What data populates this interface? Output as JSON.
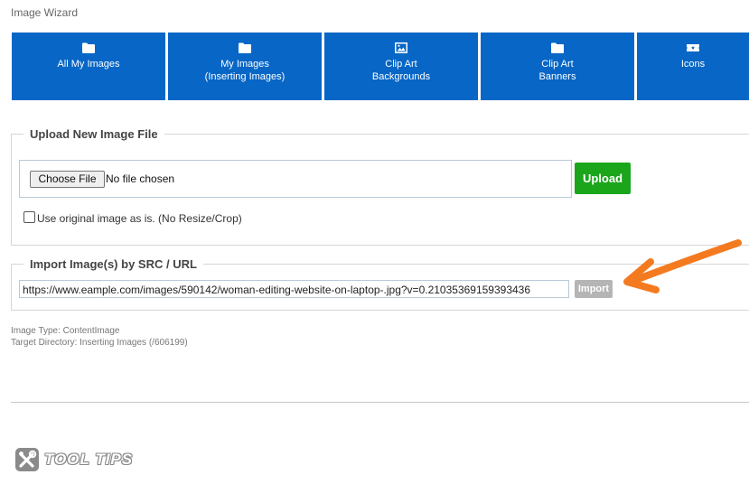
{
  "header": {
    "title": "Image Wizard"
  },
  "tabs": [
    {
      "line1": "All My Images",
      "line2": "",
      "icon": "folder-icon"
    },
    {
      "line1": "My Images",
      "line2": "(Inserting Images)",
      "icon": "folder-icon"
    },
    {
      "line1": "Clip Art",
      "line2": "Backgrounds",
      "icon": "image-frame-icon"
    },
    {
      "line1": "Clip Art",
      "line2": "Banners",
      "icon": "folder-icon"
    },
    {
      "line1": "Icons",
      "line2": "",
      "icon": "ticket-icon"
    }
  ],
  "upload": {
    "legend": "Upload New Image File",
    "choose_label": "Choose File",
    "no_file_text": "No file chosen",
    "upload_label": "Upload",
    "checkbox_label": "Use original image as is. (No Resize/Crop)",
    "checkbox_checked": false
  },
  "import": {
    "legend": "Import Image(s) by SRC / URL",
    "url_value": "https://www.eample.com/images/590142/woman-editing-website-on-laptop-.jpg?v=0.21035369159393436",
    "button_label": "Import"
  },
  "meta": {
    "image_type": "Image Type: ContentImage",
    "target_directory": "Target Directory: Inserting Images (/606199)"
  },
  "watermark": {
    "text": "TOOL TIPS"
  },
  "colors": {
    "tab_blue": "#0766c6",
    "upload_green": "#1aa51a",
    "import_gray": "#b5b5b5",
    "arrow_orange": "#f47a20"
  }
}
